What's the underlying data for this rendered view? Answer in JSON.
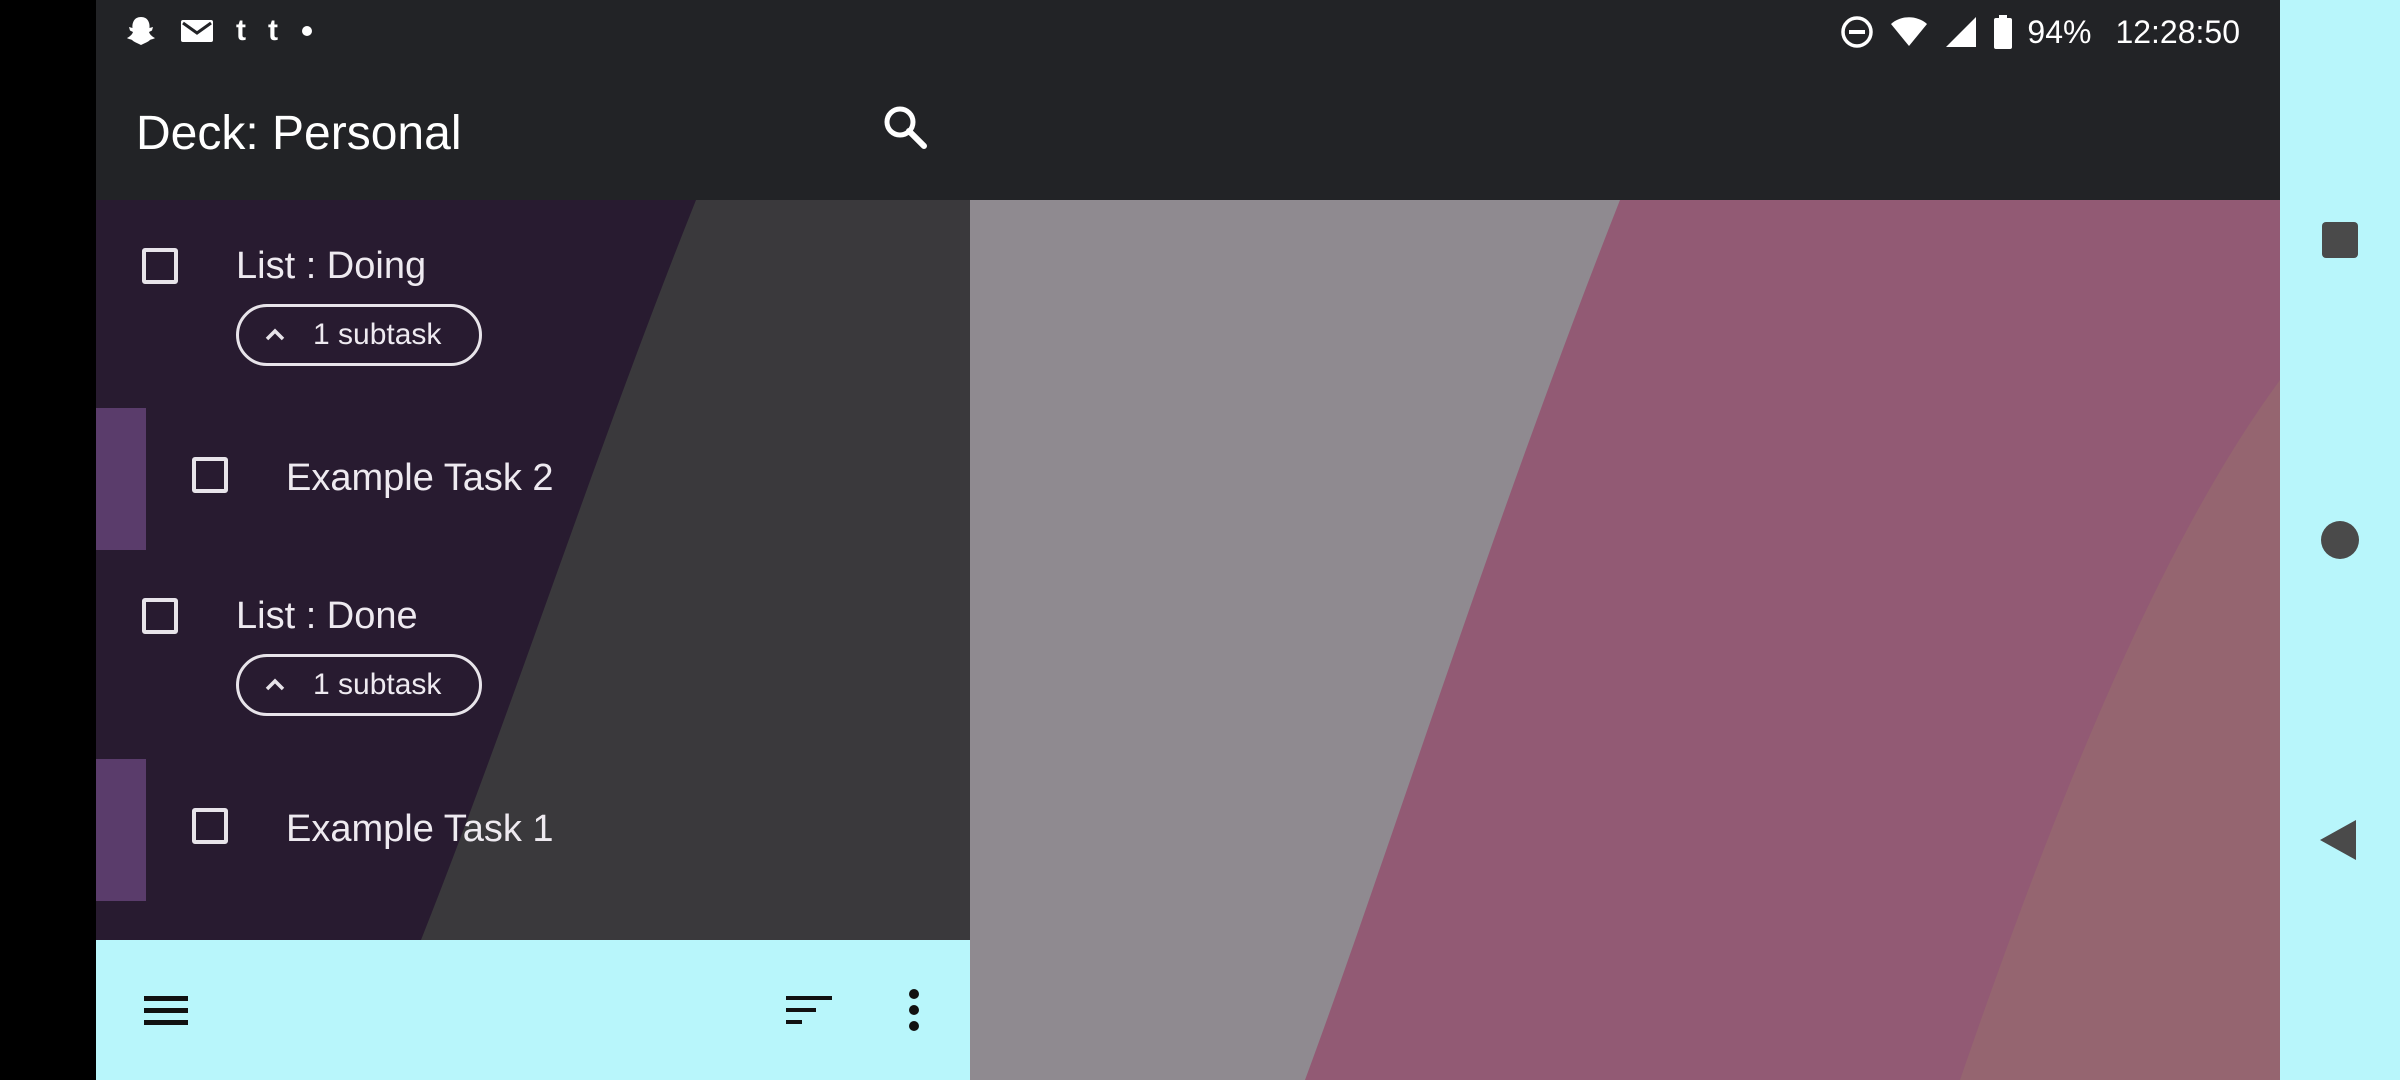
{
  "status_bar": {
    "notification_icons": [
      "snapchat-icon",
      "gmail-icon",
      "tumblr-icon",
      "tumblr-icon",
      "more-notifications-dot"
    ],
    "system_icons": [
      "do-not-disturb-icon",
      "wifi-icon",
      "cell-signal-icon",
      "battery-icon"
    ],
    "battery": "94%",
    "time": "12:28:50"
  },
  "app_bar": {
    "title": "Deck: Personal",
    "search_icon": "search-icon"
  },
  "tasks": [
    {
      "title": "List : Doing",
      "subtask_chip": "1 subtask",
      "subtasks": [
        {
          "title": "Example Task 2"
        }
      ]
    },
    {
      "title": "List : Done",
      "subtask_chip": "1 subtask",
      "subtasks": [
        {
          "title": "Example Task 1"
        }
      ]
    }
  ],
  "bottom_bar": {
    "menu_icon": "menu-icon",
    "sort_icon": "sort-icon",
    "more_icon": "more-vert-icon"
  },
  "nav_bar": {
    "buttons": [
      "recents-icon",
      "home-icon",
      "back-icon"
    ]
  },
  "colors": {
    "app_bar": "#222326",
    "bottom_bar": "#b8f6fb",
    "nav_bar": "#b8f6fb",
    "subtask_accent": "#5a3c6b",
    "panel_purple": "#281b30",
    "panel_gray": "#3a393c",
    "wallpaper_gray": "#8f8a90",
    "wallpaper_pink": "#925a74"
  }
}
